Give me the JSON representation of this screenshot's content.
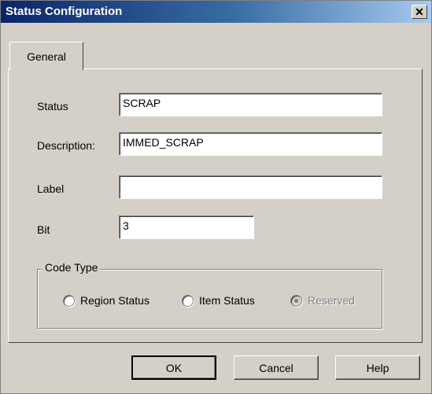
{
  "window": {
    "title": "Status Configuration",
    "close_label": "✕"
  },
  "tabs": [
    {
      "label": "General",
      "active": true
    }
  ],
  "fields": {
    "status": {
      "label": "Status",
      "value": "SCRAP"
    },
    "description": {
      "label": "Description:",
      "value": "IMMED_SCRAP"
    },
    "label": {
      "label": "Label",
      "value": ""
    },
    "bit": {
      "label": "Bit",
      "value": "3"
    }
  },
  "code_type": {
    "legend": "Code Type",
    "options": [
      {
        "label": "Region Status",
        "selected": false,
        "enabled": true
      },
      {
        "label": "Item Status",
        "selected": false,
        "enabled": true
      },
      {
        "label": "Reserved",
        "selected": true,
        "enabled": false
      }
    ]
  },
  "buttons": {
    "ok": "OK",
    "cancel": "Cancel",
    "help": "Help"
  }
}
